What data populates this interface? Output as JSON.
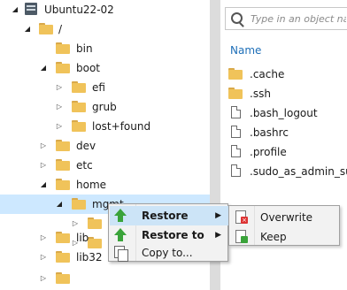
{
  "tree": {
    "root": "Ubuntu22-02",
    "items": [
      {
        "label": "/",
        "arrow": "open"
      },
      {
        "label": "bin",
        "arrow": ""
      },
      {
        "label": "boot",
        "arrow": "open"
      },
      {
        "label": "efi",
        "arrow": "closed"
      },
      {
        "label": "grub",
        "arrow": "closed"
      },
      {
        "label": "lost+found",
        "arrow": "closed"
      },
      {
        "label": "dev",
        "arrow": "closed"
      },
      {
        "label": "etc",
        "arrow": "closed"
      },
      {
        "label": "home",
        "arrow": "open"
      },
      {
        "label": "mgmt",
        "arrow": "open"
      },
      {
        "label": "",
        "arrow": "closed"
      },
      {
        "label": "",
        "arrow": "closed"
      },
      {
        "label": "lib",
        "arrow": "closed"
      },
      {
        "label": "lib32",
        "arrow": "closed"
      }
    ]
  },
  "search": {
    "placeholder": "Type in an object name to search for"
  },
  "files": {
    "column_header": "Name",
    "items": [
      {
        "name": ".cache",
        "kind": "folder"
      },
      {
        "name": ".ssh",
        "kind": "folder"
      },
      {
        "name": ".bash_logout",
        "kind": "file"
      },
      {
        "name": ".bashrc",
        "kind": "file"
      },
      {
        "name": ".profile",
        "kind": "file"
      },
      {
        "name": ".sudo_as_admin_successful",
        "kind": "file"
      }
    ]
  },
  "context_menu": {
    "restore": "Restore",
    "restore_to": "Restore to",
    "copy_to": "Copy to..."
  },
  "submenu": {
    "overwrite": "Overwrite",
    "keep": "Keep"
  }
}
